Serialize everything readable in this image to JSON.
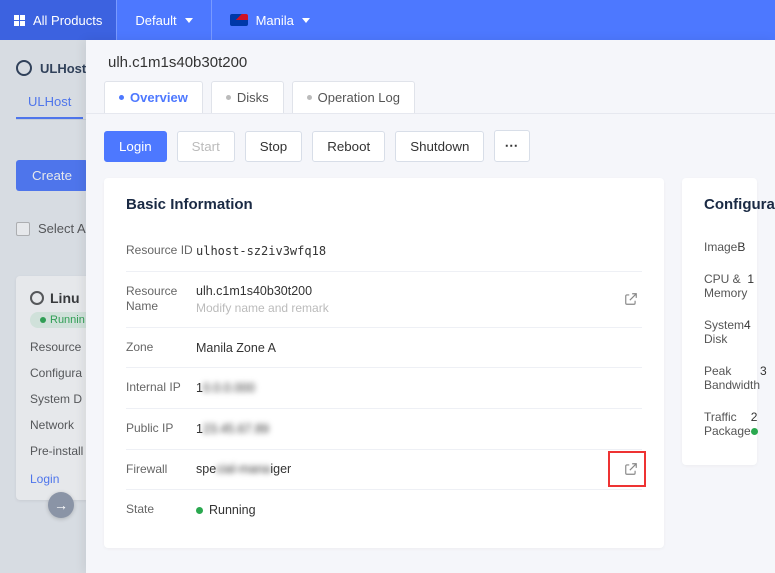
{
  "topbar": {
    "all_products": "All Products",
    "project": "Default",
    "region": "Manila"
  },
  "background": {
    "product": "ULHost",
    "tab": "ULHost",
    "create_btn": "Create",
    "select_all": "Select All",
    "card_title": "Linu",
    "card_status": "Runnin",
    "rows": [
      "Resource",
      "Configura",
      "System D",
      "Network",
      "Pre-install"
    ],
    "login": "Login"
  },
  "panel": {
    "title": "ulh.c1m1s40b30t200",
    "tabs": [
      "Overview",
      "Disks",
      "Operation Log"
    ],
    "active_tab": 0,
    "actions": {
      "login": "Login",
      "start": "Start",
      "stop": "Stop",
      "reboot": "Reboot",
      "shutdown": "Shutdown"
    }
  },
  "basic": {
    "heading": "Basic Information",
    "rows": {
      "resource_id": {
        "label": "Resource ID",
        "value": "ulhost-sz2iv3wfq18"
      },
      "resource_name": {
        "label": "Resource Name",
        "value": "ulh.c1m1s40b30t200",
        "placeholder": "Modify name and remark"
      },
      "zone": {
        "label": "Zone",
        "value": "Manila Zone A"
      },
      "internal_ip": {
        "label": "Internal IP",
        "value": "1"
      },
      "public_ip": {
        "label": "Public IP",
        "value": "1"
      },
      "firewall": {
        "label": "Firewall",
        "value": "spe             iger"
      },
      "state": {
        "label": "State",
        "value": "Running"
      }
    }
  },
  "config": {
    "heading": "Configura",
    "rows": [
      {
        "k": "Image",
        "v": "B"
      },
      {
        "k": "CPU & Memory",
        "v": "1"
      },
      {
        "k": "System Disk",
        "v": "4"
      },
      {
        "k": "Peak Bandwidth",
        "v": "3"
      },
      {
        "k": "Traffic Package",
        "v": "2"
      }
    ]
  }
}
